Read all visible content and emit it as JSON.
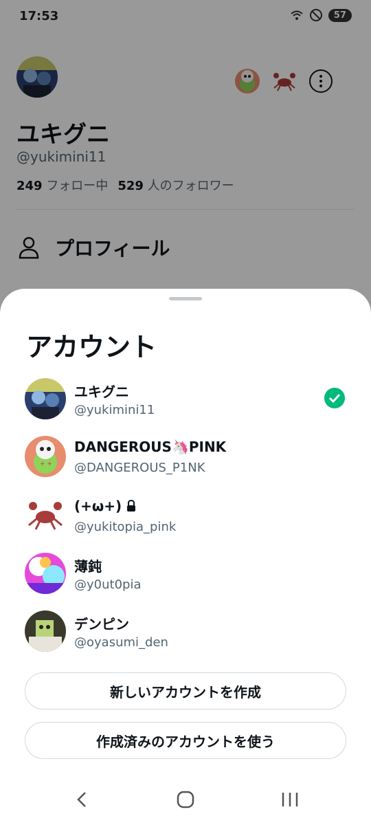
{
  "status_bar": {
    "time": "17:53",
    "battery": "57"
  },
  "profile": {
    "name": "ユキグニ",
    "handle": "@yukimini11",
    "following_count": "249",
    "following_label": "フォロー中",
    "followers_count": "529",
    "followers_label": "人のフォロワー",
    "menu_profile_label": "プロフィール"
  },
  "sheet": {
    "title": "アカウント",
    "accounts": [
      {
        "name": "ユキグニ",
        "handle": "@yukimini11",
        "selected": true
      },
      {
        "name": "DANGEROUS🦄PINK",
        "handle": "@DANGEROUS_P1NK",
        "selected": false
      },
      {
        "name": "(+ω+)",
        "handle": "@yukitopia_pink",
        "selected": false,
        "locked": true
      },
      {
        "name": "薄鈍",
        "handle": "@y0ut0pia",
        "selected": false
      },
      {
        "name": "デンピン",
        "handle": "@oyasumi_den",
        "selected": false
      }
    ],
    "create_account_label": "新しいアカウントを作成",
    "use_existing_label": "作成済みのアカウントを使う"
  },
  "colors": {
    "accent_check": "#00ba7c",
    "text_primary": "#0f1419",
    "text_secondary": "#536471"
  },
  "icons": [
    "wifi-icon",
    "no-disturb-icon",
    "more-options-icon",
    "person-icon",
    "check-icon",
    "lock-icon",
    "back-icon",
    "home-icon",
    "recents-icon"
  ]
}
